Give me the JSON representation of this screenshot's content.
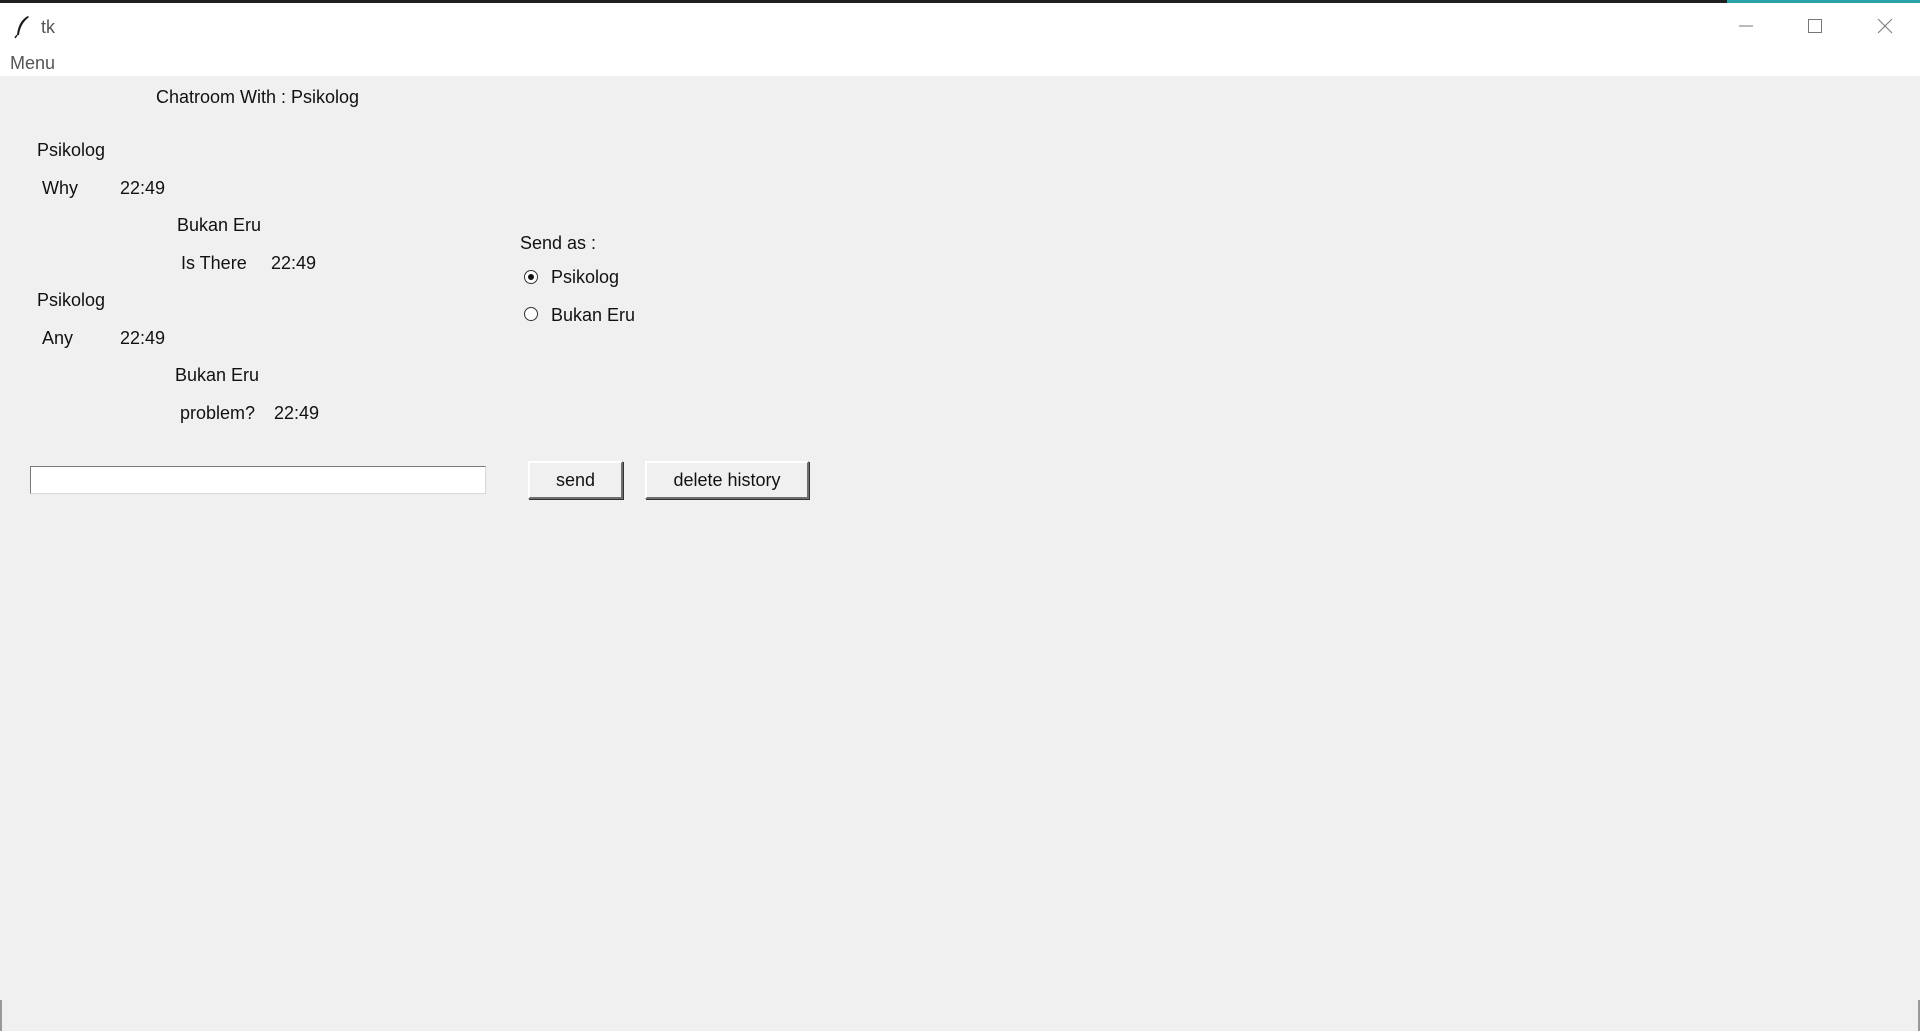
{
  "window": {
    "title": "tk",
    "icon": "feather-icon",
    "controls": [
      "minimize-icon",
      "maximize-icon",
      "close-icon"
    ]
  },
  "menubar": {
    "items": [
      {
        "label": "Menu"
      }
    ]
  },
  "chat": {
    "header": "Chatroom With : Psikolog",
    "messages": [
      {
        "sender": "Psikolog",
        "text": "Why",
        "time": "22:49",
        "align": "left"
      },
      {
        "sender": "Bukan Eru",
        "text": "Is There",
        "time": "22:49",
        "align": "right"
      },
      {
        "sender": "Psikolog",
        "text": "Any",
        "time": "22:49",
        "align": "left"
      },
      {
        "sender": "Bukan Eru",
        "text": "problem?",
        "time": "22:49",
        "align": "right"
      }
    ]
  },
  "send_as": {
    "label": "Send as :",
    "options": [
      {
        "label": "Psikolog",
        "selected": true
      },
      {
        "label": "Bukan Eru",
        "selected": false
      }
    ]
  },
  "composer": {
    "input_value": "",
    "send_label": "send",
    "delete_label": "delete history"
  }
}
